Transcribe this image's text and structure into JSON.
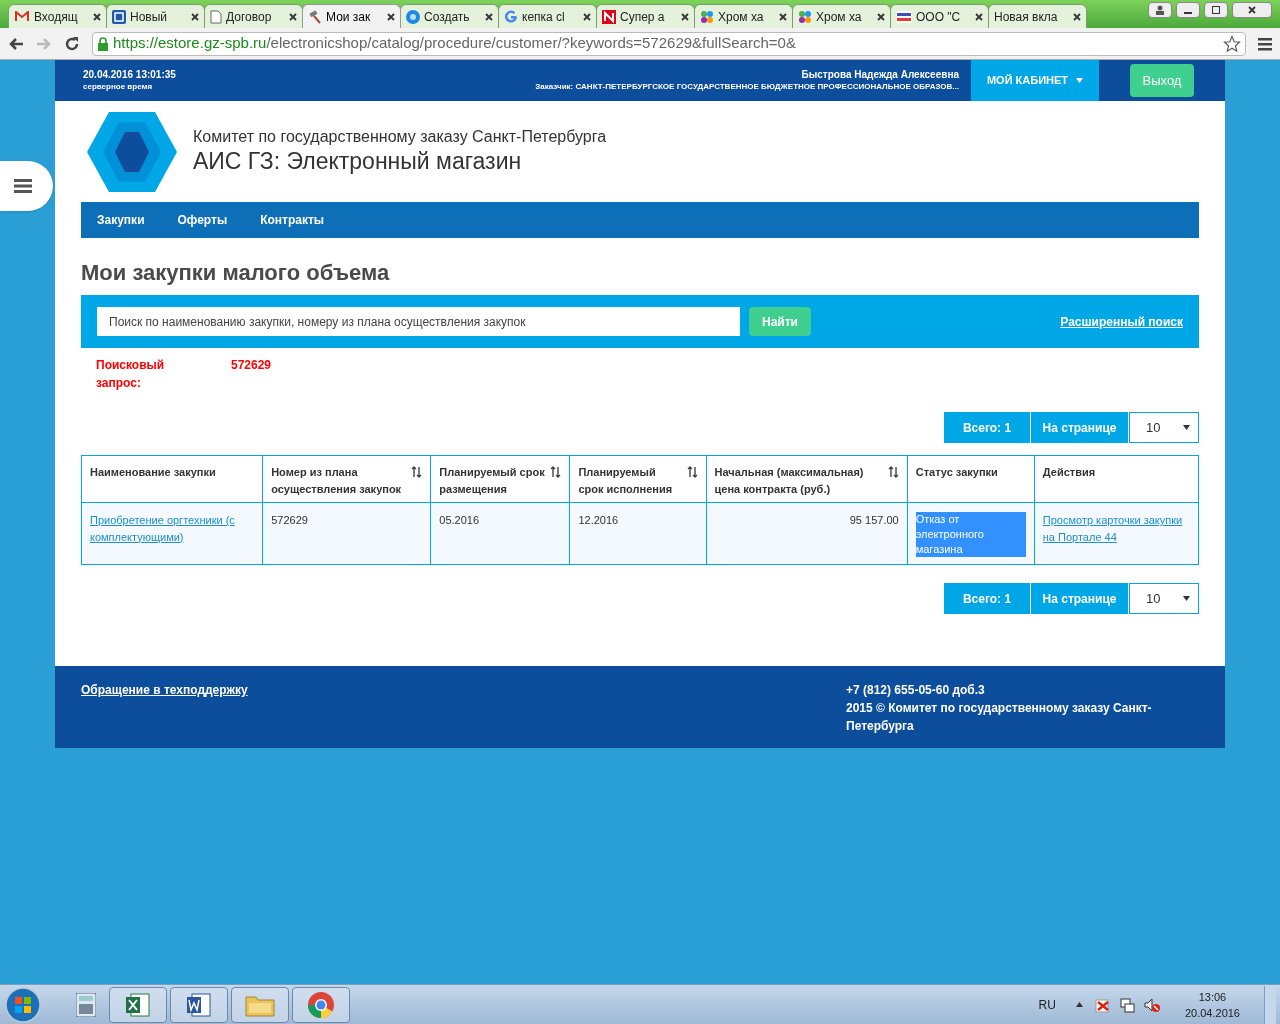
{
  "browser": {
    "tabs": [
      {
        "label": "Входящ",
        "selected": false
      },
      {
        "label": "Новый",
        "selected": false
      },
      {
        "label": "Договор",
        "selected": false
      },
      {
        "label": "Мои зак",
        "selected": true
      },
      {
        "label": "Создать",
        "selected": false
      },
      {
        "label": "кепка cl",
        "selected": false
      },
      {
        "label": "Супер а",
        "selected": false
      },
      {
        "label": "Хром ха",
        "selected": false
      },
      {
        "label": "Хром ха",
        "selected": false
      },
      {
        "label": "ООО \"С",
        "selected": false
      },
      {
        "label": "Новая вкла",
        "selected": false
      }
    ],
    "url_host": "https://estore.gz-spb.ru",
    "url_path": "/electronicshop/catalog/procedure/customer/?keywords=572629&fullSearch=0&"
  },
  "topbar": {
    "datetime": "20.04.2016 13:01:35",
    "time_note": "серверное время",
    "user": "Быстрова Надежда Алексеевна",
    "customer": "Заказчик: САНКТ-ПЕТЕРБУРГСКОЕ ГОСУДАРСТВЕННОЕ БЮДЖЕТНОЕ ПРОФЕССИОНАЛЬНОЕ ОБРАЗОВ...",
    "cabinet_button": "МОЙ КАБИНЕТ",
    "logout_button": "Выход"
  },
  "header": {
    "org": "Комитет по государственному заказу Санкт-Петербурга",
    "app": "АИС ГЗ: Электронный магазин"
  },
  "nav": [
    "Закупки",
    "Оферты",
    "Контракты"
  ],
  "page_title": "Мои закупки малого объема",
  "search": {
    "placeholder": "Поиск по наименованию закупки, номеру из плана осуществления закупок",
    "button": "Найти",
    "advanced_link": "Расширенный поиск"
  },
  "query": {
    "label": "Поисковый запрос:",
    "value": "572629"
  },
  "pager_top": {
    "total": "Всего: 1",
    "per_page_label": "На странице",
    "per_page": "10"
  },
  "table": {
    "columns": [
      {
        "label": "Наименование закупки",
        "sortable": false
      },
      {
        "label": "Номер из плана осуществления закупок",
        "sortable": true
      },
      {
        "label": "Планируемый срок размещения",
        "sortable": true
      },
      {
        "label": "Планируемый срок исполнения",
        "sortable": true
      },
      {
        "label": "Начальная (максимальная) цена контракта (руб.)",
        "sortable": true
      },
      {
        "label": "Статус закупки",
        "sortable": false
      },
      {
        "label": "Действия",
        "sortable": false
      }
    ],
    "rows": [
      {
        "name": "Приобретение оргтехники (с комплектующими)",
        "plan_number": "572629",
        "placement": "05.2016",
        "execution": "12.2016",
        "price": "95 157.00",
        "status": "Отказ от электронного магазина",
        "status_highlighted": true,
        "action": "Просмотр карточки закупки на Портале 44"
      }
    ]
  },
  "pager_bottom": {
    "total": "Всего: 1",
    "per_page_label": "На странице",
    "per_page": "10"
  },
  "footer": {
    "support_link": "Обращение в техподдержку",
    "phone": "+7 (812) 655-05-60 доб.3",
    "copyright": "2015 © Комитет по государственному заказу Санкт-Петербурга"
  },
  "taskbar": {
    "language": "RU",
    "time": "13:06",
    "date": "20.04.2016"
  }
}
